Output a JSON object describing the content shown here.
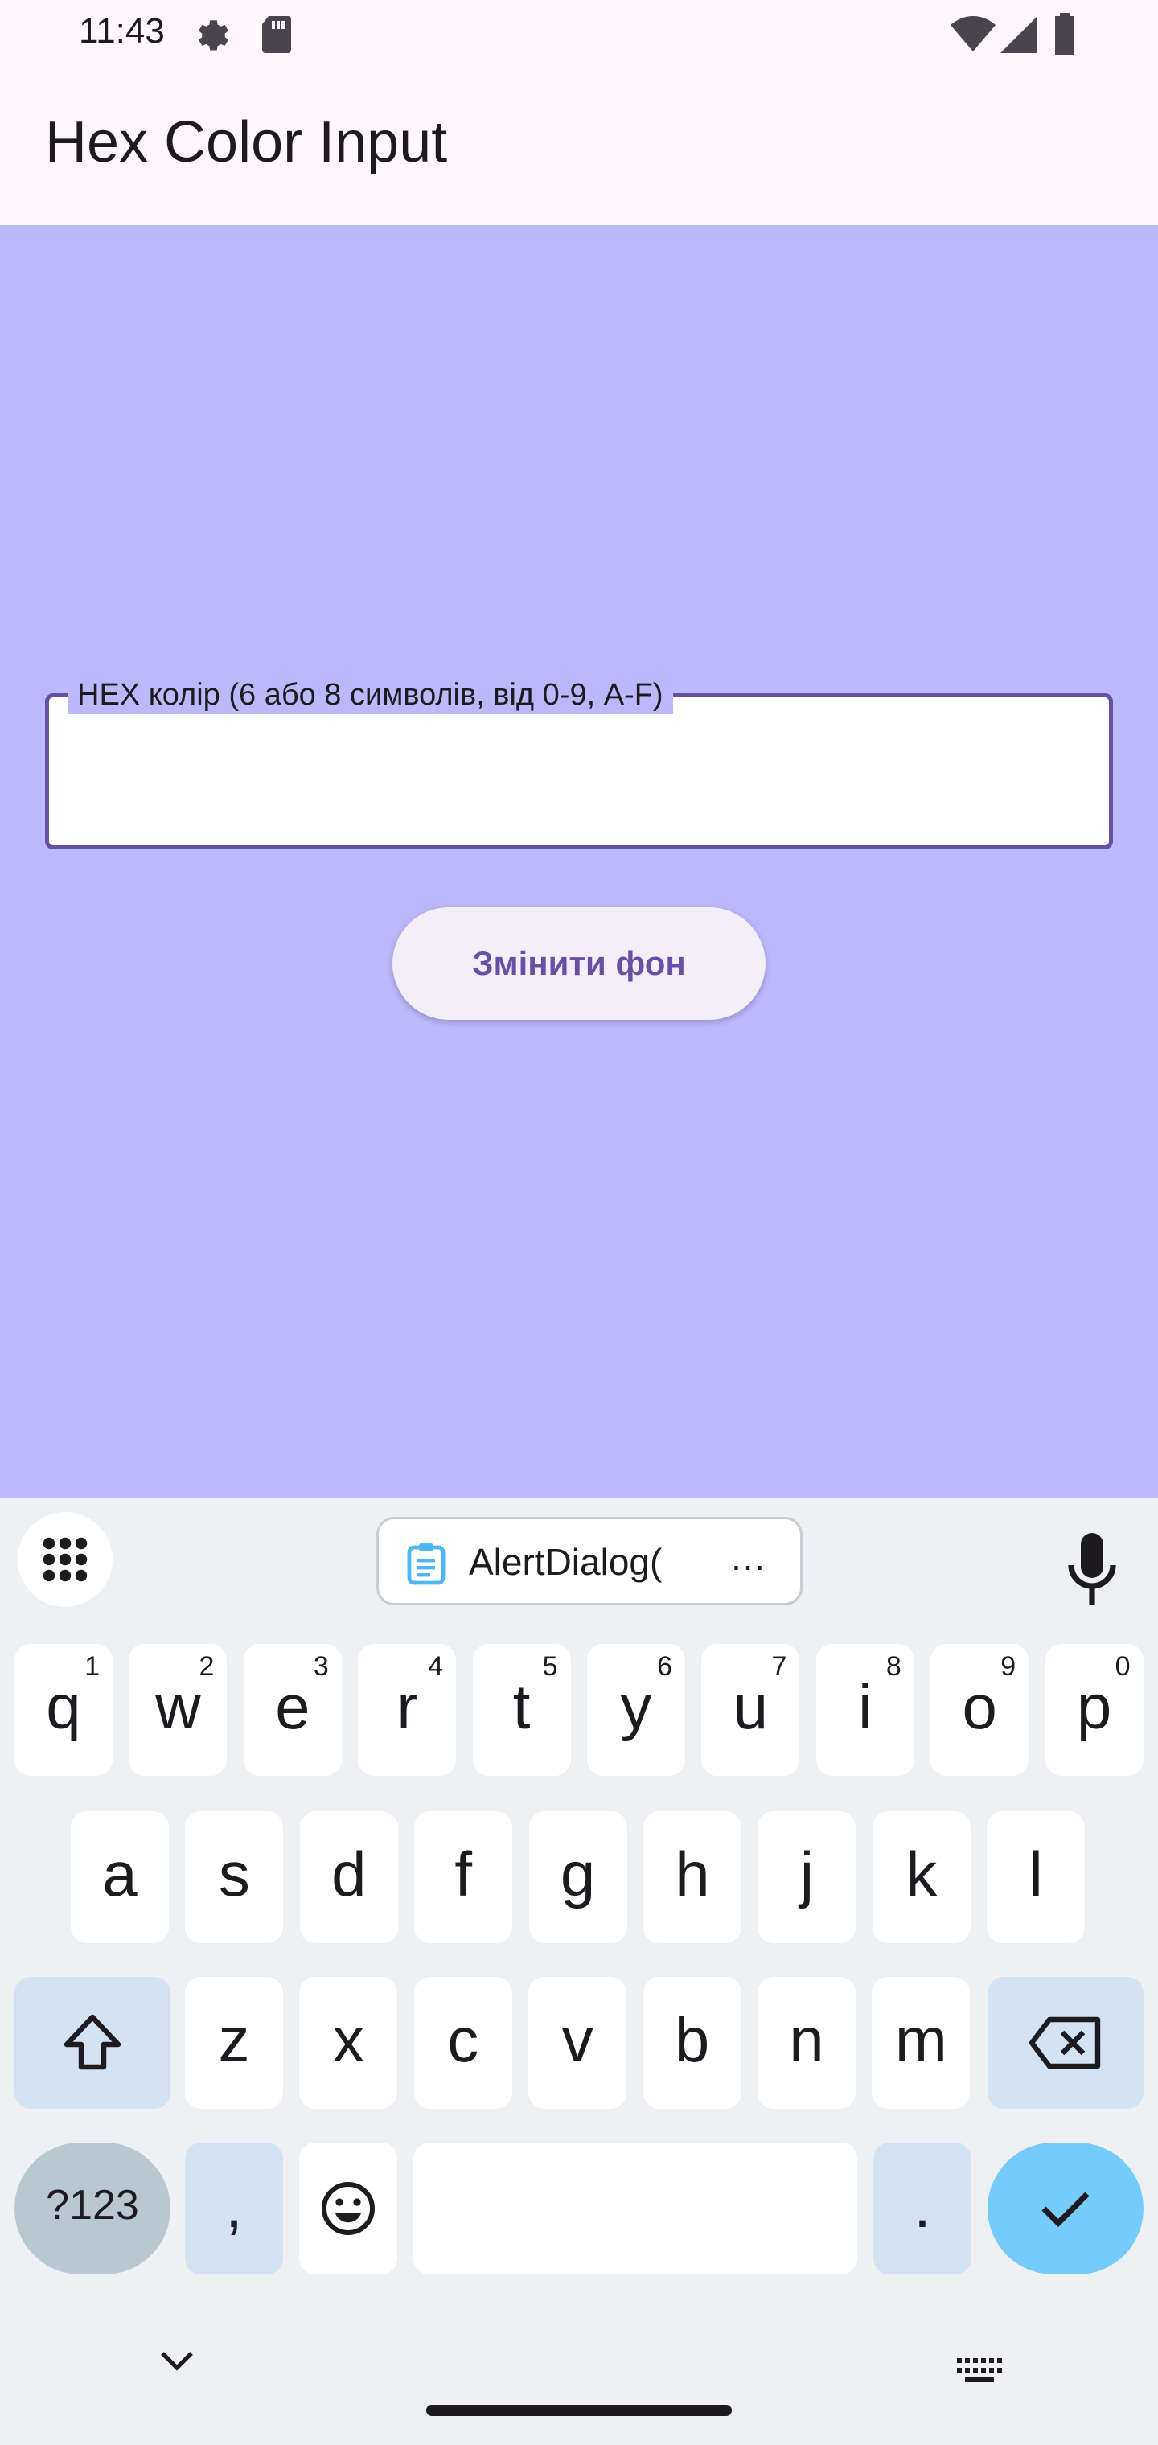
{
  "status_bar": {
    "time": "11:43"
  },
  "app_bar": {
    "title": "Hex Color Input"
  },
  "form": {
    "hex_label": "HEX колір (6 або 8 символів, від 0-9, A-F)",
    "hex_value": "",
    "button_label": "Змінити фон"
  },
  "colors": {
    "background": "#bcb8fc",
    "accent": "#6750a4",
    "keyboard": "#eff0f3"
  },
  "keyboard": {
    "clipboard_text": "AlertDialog(",
    "clipboard_ellipsis": "…",
    "row1": [
      {
        "key": "q",
        "hint": "1"
      },
      {
        "key": "w",
        "hint": "2"
      },
      {
        "key": "e",
        "hint": "3"
      },
      {
        "key": "r",
        "hint": "4"
      },
      {
        "key": "t",
        "hint": "5"
      },
      {
        "key": "y",
        "hint": "6"
      },
      {
        "key": "u",
        "hint": "7"
      },
      {
        "key": "i",
        "hint": "8"
      },
      {
        "key": "o",
        "hint": "9"
      },
      {
        "key": "p",
        "hint": "0"
      }
    ],
    "row2": [
      "a",
      "s",
      "d",
      "f",
      "g",
      "h",
      "j",
      "k",
      "l"
    ],
    "row3": [
      "z",
      "x",
      "c",
      "v",
      "b",
      "n",
      "m"
    ],
    "symbols_key": "?123",
    "comma_key": ",",
    "period_key": "."
  }
}
